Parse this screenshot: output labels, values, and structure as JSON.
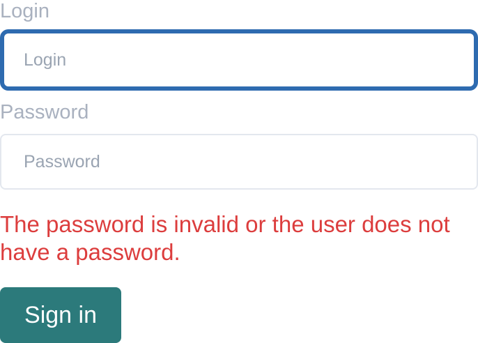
{
  "login": {
    "label": "Login",
    "placeholder": "Login",
    "value": ""
  },
  "password": {
    "label": "Password",
    "placeholder": "Password",
    "value": ""
  },
  "error": {
    "message": "The password is invalid or the user does not have a password."
  },
  "submit": {
    "label": "Sign in"
  },
  "colors": {
    "focus_border": "#2e6bb0",
    "error_text": "#dc3d3d",
    "button_bg": "#2c7a7b",
    "label_text": "#a9b1bf"
  }
}
